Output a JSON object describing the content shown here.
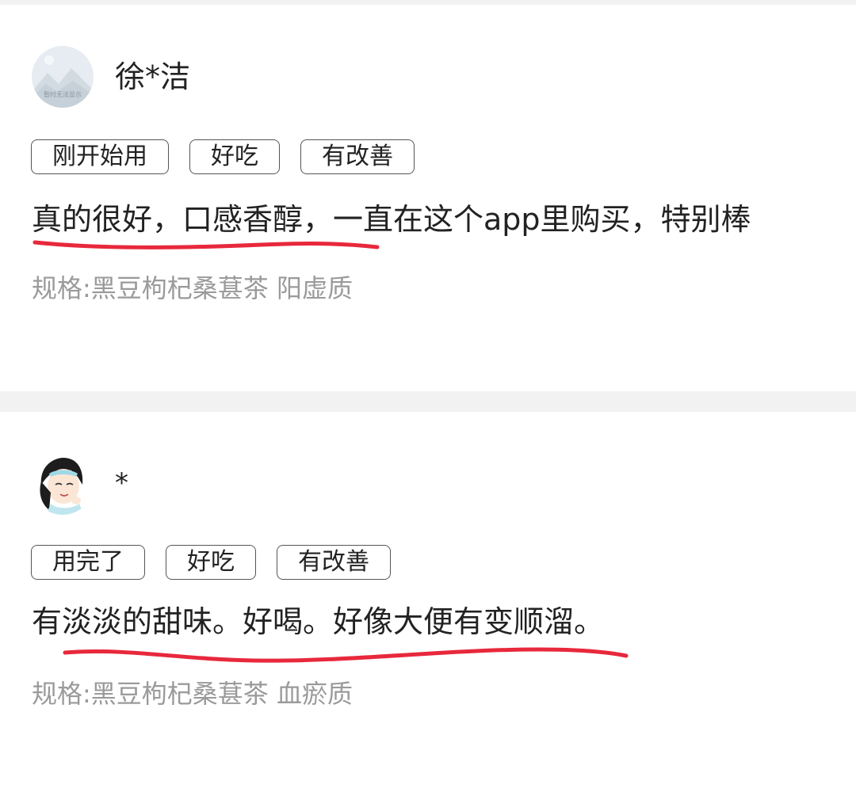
{
  "reviews": [
    {
      "username": "徐*洁",
      "avatar_caption": "暂时无法显示",
      "tags": [
        "刚开始用",
        "好吃",
        "有改善"
      ],
      "content": "真的很好，口感香醇，一直在这个app里购买，特别棒",
      "spec": "规格:黑豆枸杞桑葚茶 阳虚质"
    },
    {
      "username": "*",
      "tags": [
        "用完了",
        "好吃",
        "有改善"
      ],
      "content": "有淡淡的甜味。好喝。好像大便有变顺溜。",
      "spec": "规格:黑豆枸杞桑葚茶 血瘀质"
    }
  ],
  "colors": {
    "underline": "#e8283c",
    "spec_text": "#9a9a9a",
    "separator": "#f2f2f2"
  }
}
